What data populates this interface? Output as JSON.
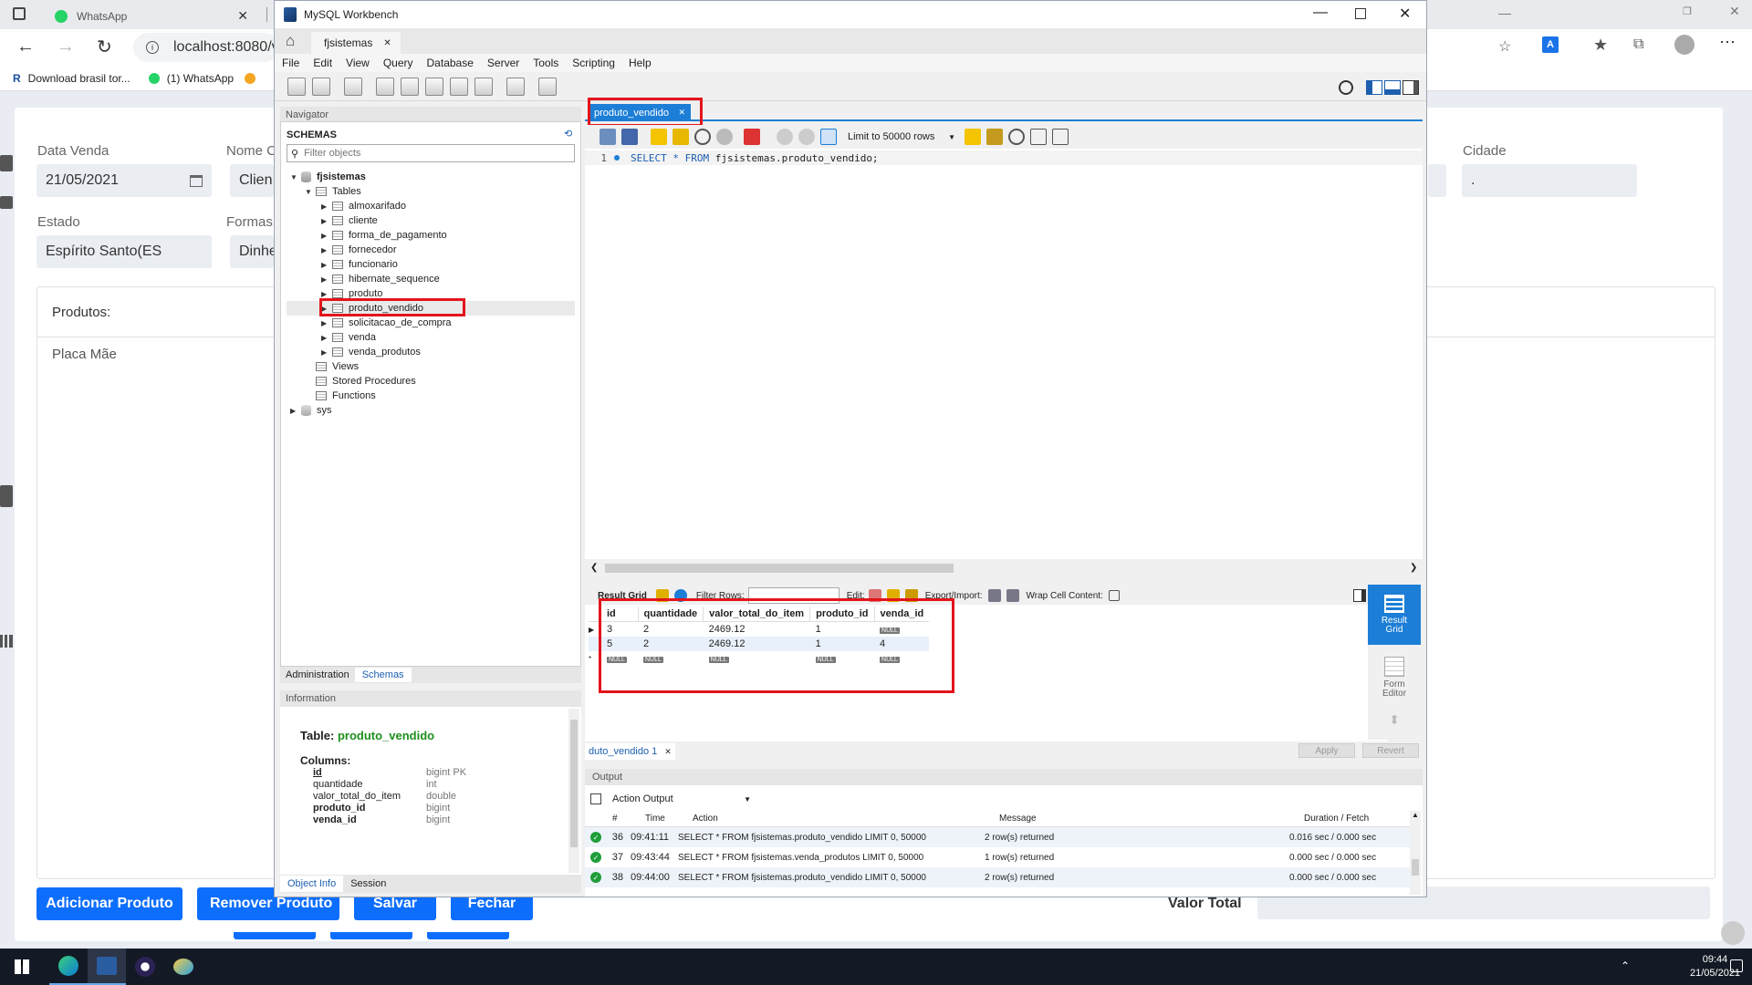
{
  "browser": {
    "tabs": [
      {
        "label": "WhatsApp"
      }
    ],
    "address": "localhost:8080/v",
    "bookmarks": [
      "Download brasil tor...",
      "(1) WhatsApp"
    ]
  },
  "form": {
    "data_venda_label": "Data Venda",
    "data_venda_value": "21/05/2021",
    "nome_label": "Nome C",
    "nome_value": "Clien",
    "cidade_label": "Cidade",
    "cidade_value": ".",
    "estado_label": "Estado",
    "estado_value": "Espírito Santo(ES",
    "formas_label": "Formas",
    "formas_value": "Dinhe",
    "produtos_label": "Produtos:",
    "produto_item": "Placa Mãe",
    "buttons": {
      "add": "Adicionar Produto",
      "remove": "Remover Produto",
      "save": "Salvar",
      "close": "Fechar"
    },
    "valor_total_label": "Valor Total"
  },
  "workbench": {
    "title": "MySQL Workbench",
    "connection_tab": "fjsistemas",
    "menu": [
      "File",
      "Edit",
      "View",
      "Query",
      "Database",
      "Server",
      "Tools",
      "Scripting",
      "Help"
    ],
    "navigator": {
      "header": "Navigator",
      "schemas_title": "SCHEMAS",
      "filter_placeholder": "Filter objects",
      "schema": "fjsistemas",
      "tables_label": "Tables",
      "tables": [
        "almoxarifado",
        "cliente",
        "forma_de_pagamento",
        "fornecedor",
        "funcionario",
        "hibernate_sequence",
        "produto",
        "produto_vendido",
        "solicitacao_de_compra",
        "venda",
        "venda_produtos"
      ],
      "views": "Views",
      "procs": "Stored Procedures",
      "functions": "Functions",
      "sys": "sys",
      "tab_admin": "Administration",
      "tab_schemas": "Schemas",
      "info_header": "Information",
      "table_label": "Table:",
      "table_name": "produto_vendido",
      "columns_label": "Columns:",
      "columns": [
        {
          "name": "id",
          "type": "bigint PK",
          "bold": true
        },
        {
          "name": "quantidade",
          "type": "int",
          "bold": false
        },
        {
          "name": "valor_total_do_item",
          "type": "double",
          "bold": false
        },
        {
          "name": "produto_id",
          "type": "bigint",
          "bold": true
        },
        {
          "name": "venda_id",
          "type": "bigint",
          "bold": true
        }
      ],
      "tab_objinfo": "Object Info",
      "tab_session": "Session"
    },
    "editor": {
      "query_tab": "produto_vendido",
      "limit": "Limit to 50000 rows",
      "line_no": "1",
      "kw_select": "SELECT",
      "kw_star": "*",
      "kw_from": "FROM",
      "sql_rest": "fjsistemas.produto_vendido;"
    },
    "result": {
      "label": "Result Grid",
      "filter_label": "Filter Rows:",
      "edit_label": "Edit:",
      "export_label": "Export/Import:",
      "wrap_label": "Wrap Cell Content:",
      "columns": [
        "id",
        "quantidade",
        "valor_total_do_item",
        "produto_id",
        "venda_id"
      ],
      "rows": [
        [
          "3",
          "2",
          "2469.12",
          "1",
          "NULL"
        ],
        [
          "5",
          "2",
          "2469.12",
          "1",
          "4"
        ],
        [
          "NULL",
          "NULL",
          "NULL",
          "NULL",
          "NULL"
        ]
      ],
      "side_result_grid": "Result Grid",
      "side_form_editor": "Form Editor",
      "result_tab": "duto_vendido 1",
      "apply": "Apply",
      "revert": "Revert"
    },
    "output": {
      "header": "Output",
      "selector": "Action Output",
      "columns": [
        "#",
        "Time",
        "Action",
        "Message",
        "Duration / Fetch"
      ],
      "rows": [
        {
          "n": "36",
          "time": "09:41:11",
          "action": "SELECT * FROM fjsistemas.produto_vendido LIMIT 0, 50000",
          "message": "2 row(s) returned",
          "duration": "0.016 sec / 0.000 sec"
        },
        {
          "n": "37",
          "time": "09:43:44",
          "action": "SELECT * FROM fjsistemas.venda_produtos LIMIT 0, 50000",
          "message": "1 row(s) returned",
          "duration": "0.000 sec / 0.000 sec"
        },
        {
          "n": "38",
          "time": "09:44:00",
          "action": "SELECT * FROM fjsistemas.produto_vendido LIMIT 0, 50000",
          "message": "2 row(s) returned",
          "duration": "0.000 sec / 0.000 sec"
        }
      ]
    }
  },
  "taskbar": {
    "time": "09:44",
    "date": "21/05/2021"
  },
  "colors": {
    "accent": "#0d6efd",
    "highlight": "#e3141b",
    "wb_blue": "#1c7ed6"
  }
}
